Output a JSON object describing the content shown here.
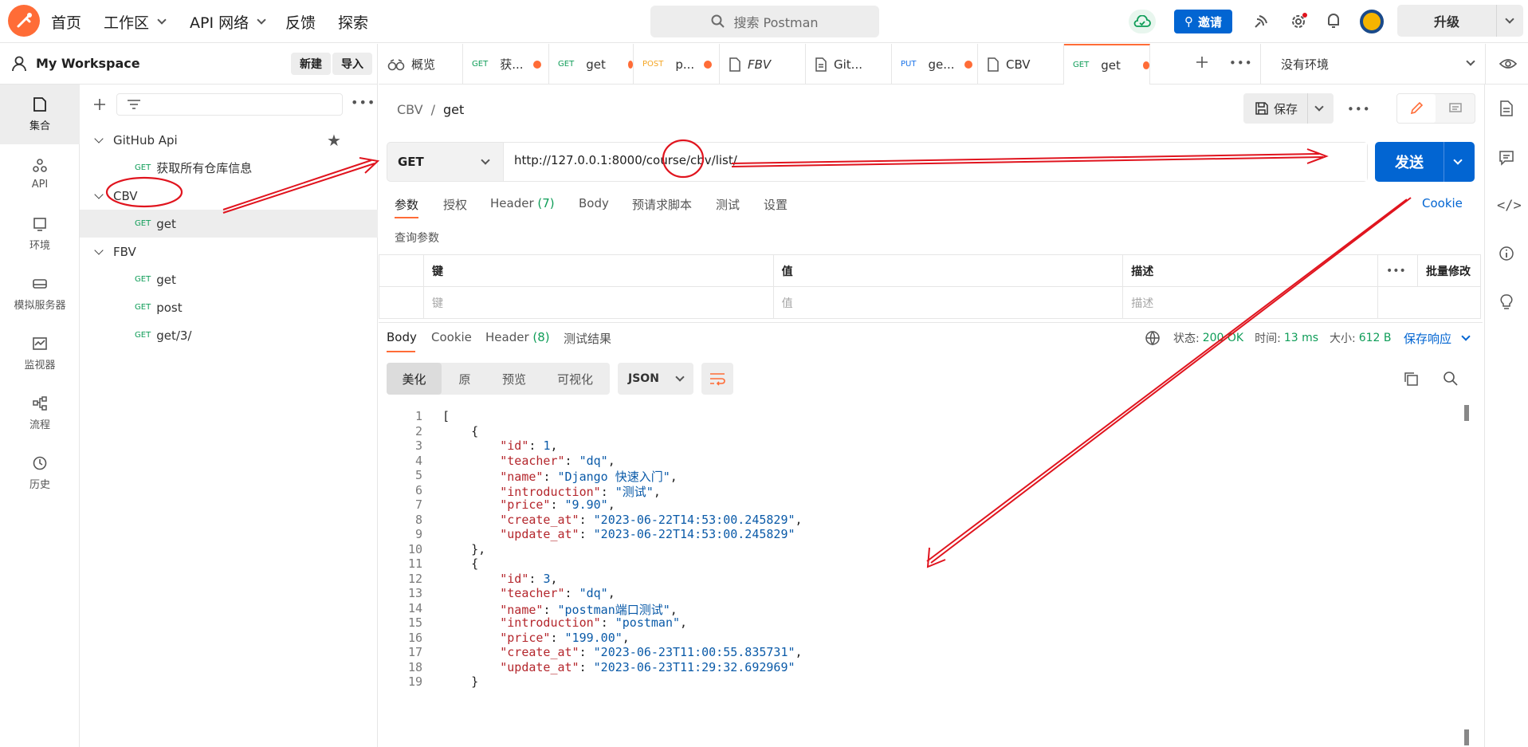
{
  "topbar": {
    "home": "首页",
    "workspace": "工作区",
    "api_network": "API 网络",
    "feedback": "反馈",
    "explore": "探索",
    "search_placeholder": "搜索 Postman",
    "invite": "邀请",
    "upgrade": "升级"
  },
  "workspace": {
    "name": "My Workspace",
    "new": "新建",
    "import": "导入"
  },
  "rail": [
    "集合",
    "API",
    "环境",
    "模拟服务器",
    "监视器",
    "流程",
    "历史"
  ],
  "tree": {
    "github": "GitHub Api",
    "github_req_method": "GET",
    "github_req": "获取所有仓库信息",
    "cbv": "CBV",
    "cbv_req_method": "GET",
    "cbv_req": "get",
    "fbv": "FBV",
    "fbv_req1_method": "GET",
    "fbv_req1": "get",
    "fbv_req2_method": "GET",
    "fbv_req2": "post",
    "fbv_req3_method": "GET",
    "fbv_req3": "get/3/"
  },
  "tabs": {
    "overview": "概览",
    "t1m": "GET",
    "t1": "获...",
    "t2m": "GET",
    "t2": "get",
    "t3m": "POST",
    "t3": "p...",
    "t4": "FBV",
    "t5": "Git...",
    "t6m": "PUT",
    "t6": "ge...",
    "t7": "CBV",
    "t8m": "GET",
    "t8": "get",
    "env": "没有环境"
  },
  "request": {
    "crumb_parent": "CBV",
    "crumb_sep": "/",
    "crumb_name": "get",
    "save": "保存",
    "method": "GET",
    "url": "http://127.0.0.1:8000/course/cbv/list/",
    "send": "发送"
  },
  "req_tabs": {
    "params": "参数",
    "auth": "授权",
    "headers": "Header",
    "headers_count": "(7)",
    "body": "Body",
    "prescript": "预请求脚本",
    "tests": "测试",
    "settings": "设置",
    "cookie": "Cookie",
    "query_params": "查询参数"
  },
  "params_table": {
    "key": "键",
    "value": "值",
    "desc": "描述",
    "bulk": "批量修改",
    "key_ph": "键",
    "value_ph": "值",
    "desc_ph": "描述"
  },
  "response": {
    "body": "Body",
    "cookie": "Cookie",
    "headers": "Header",
    "headers_count": "(8)",
    "test_results": "测试结果",
    "status_label": "状态:",
    "status": "200 OK",
    "time_label": "时间:",
    "time": "13 ms",
    "size_label": "大小:",
    "size": "612 B",
    "save": "保存响应",
    "pretty": "美化",
    "raw": "原",
    "preview": "预览",
    "visualize": "可视化",
    "format": "JSON"
  },
  "code_lines": [
    "[",
    "    {",
    "        \"id\": 1,",
    "        \"teacher\": \"dq\",",
    "        \"name\": \"Django 快速入门\",",
    "        \"introduction\": \"测试\",",
    "        \"price\": \"9.90\",",
    "        \"create_at\": \"2023-06-22T14:53:00.245829\",",
    "        \"update_at\": \"2023-06-22T14:53:00.245829\"",
    "    },",
    "    {",
    "        \"id\": 3,",
    "        \"teacher\": \"dq\",",
    "        \"name\": \"postman端口测试\",",
    "        \"introduction\": \"postman\",",
    "        \"price\": \"199.00\",",
    "        \"create_at\": \"2023-06-23T11:00:55.835731\",",
    "        \"update_at\": \"2023-06-23T11:29:32.692969\"",
    "    }"
  ],
  "colors": {
    "accent": "#ff6c37",
    "primary": "#0265d2",
    "annotation": "#e0141e"
  }
}
